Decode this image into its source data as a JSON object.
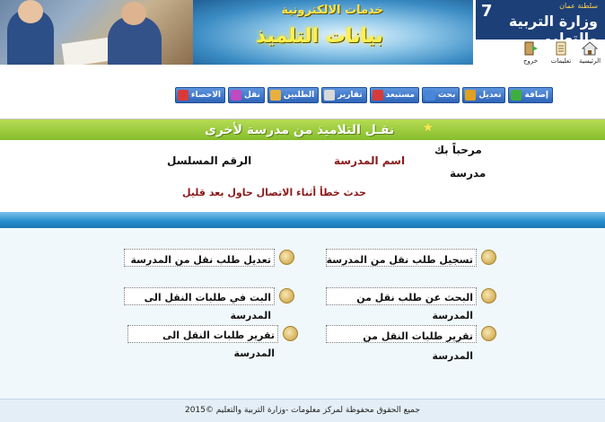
{
  "header": {
    "subtitle": "خدمات الالكترونية",
    "title": "بيانات التلميذ",
    "ministry_name": "وزارة التربية والتعليم",
    "ministry_small": "سلطنة عمان",
    "ministry_number": "7"
  },
  "quick_icons": [
    {
      "label": "الرئيسية",
      "icon": "home-icon"
    },
    {
      "label": "تعليمات",
      "icon": "document-icon"
    },
    {
      "label": "خروج",
      "icon": "exit-icon"
    }
  ],
  "toolbar": {
    "items": [
      {
        "label": "إضافة",
        "icon": "add-icon",
        "color": "#3fae3f"
      },
      {
        "label": "تعديل",
        "icon": "edit-icon",
        "color": "#e0a020"
      },
      {
        "label": "بحث",
        "icon": "search-icon",
        "color": "#4a86d8"
      },
      {
        "label": "مستبعد",
        "icon": "exclude-icon",
        "color": "#d83a3a"
      },
      {
        "label": "تقارير",
        "icon": "report-icon",
        "color": "#d8d8d8"
      },
      {
        "label": "الطلبين",
        "icon": "users-icon",
        "color": "#e8b040"
      },
      {
        "label": "نقل",
        "icon": "transfer-icon",
        "color": "#c04ac0"
      },
      {
        "label": "الاحصاء",
        "icon": "chart-icon",
        "color": "#d83a3a"
      }
    ]
  },
  "section": {
    "title": "نقـل التلاميذ من مدرسة لأخرى"
  },
  "info": {
    "welcome": "مرحباً بك",
    "school_word": "مدرسة",
    "school_name_label": "اسم المدرسة",
    "serial_label": "الرقم المسلسل",
    "error": "حدث خطأ أثناء الاتصال حاول بعد قليل"
  },
  "menu": {
    "register_transfer": "تسجيل طلب نقل من المدرسة",
    "edit_transfer": "تعديل طلب نقل من المدرسة",
    "search_transfer": "البحث عن طلب نقل من المدرسة",
    "decide_transfer": "البت في طلبات النقل الى المدرسة",
    "report_from": "تقرير طلبات النقل من المدرسة",
    "report_to": "تقرير طلبات النقل الى المدرسة"
  },
  "footer": {
    "copyright": "جميع الحقوق محفوظة لمركز معلومات -وزارة التربية والتعليم ©2015"
  },
  "colors": {
    "green_header": "#86bd2c",
    "blue_bar": "#2a90cf",
    "toolbar_blue": "#2f64b8"
  }
}
